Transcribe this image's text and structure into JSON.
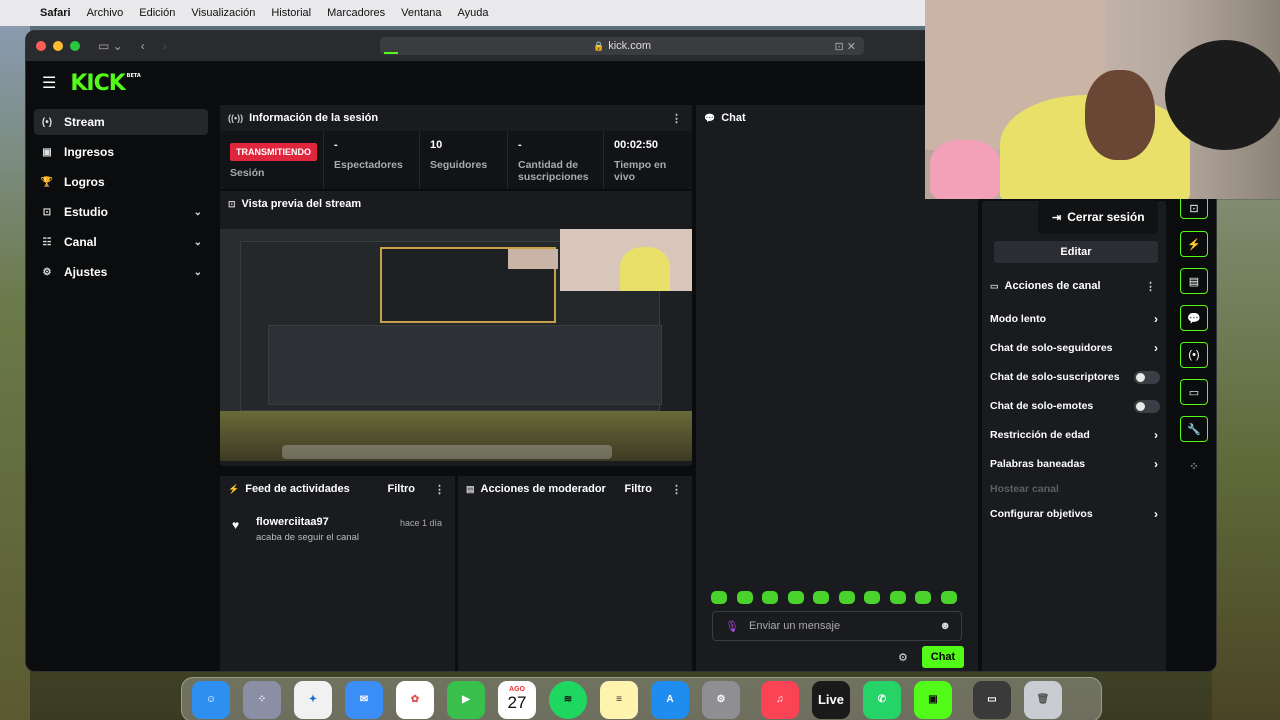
{
  "menubar": {
    "apple": "",
    "items": [
      "Safari",
      "Archivo",
      "Edición",
      "Visualización",
      "Historial",
      "Marcadores",
      "Ventana",
      "Ayuda"
    ]
  },
  "browser": {
    "url": "kick.com"
  },
  "header": {
    "logo": "KICK",
    "beta": "BETA"
  },
  "sidebar": {
    "items": [
      {
        "label": "Stream",
        "icon": "broadcast-icon"
      },
      {
        "label": "Ingresos",
        "icon": "revenue-icon"
      },
      {
        "label": "Logros",
        "icon": "trophy-icon"
      },
      {
        "label": "Estudio",
        "icon": "studio-icon"
      },
      {
        "label": "Canal",
        "icon": "channel-icon"
      },
      {
        "label": "Ajustes",
        "icon": "gear-icon"
      }
    ]
  },
  "session": {
    "title": "Información de la sesión",
    "badge": "TRANSMITIENDO",
    "session_label": "Sesión",
    "stats": [
      {
        "value": "-",
        "label": "Espectadores"
      },
      {
        "value": "10",
        "label": "Seguidores"
      },
      {
        "value": "-",
        "label": "Cantidad de suscripciones"
      },
      {
        "value": "00:02:50",
        "label": "Tiempo en vivo"
      }
    ]
  },
  "preview": {
    "title": "Vista previa del stream"
  },
  "feed": {
    "title": "Feed de actividades",
    "filter": "Filtro",
    "items": [
      {
        "user": "flowerciitaa97",
        "time": "hace 1 día",
        "action": "acaba de seguir el canal"
      }
    ]
  },
  "mod": {
    "title": "Acciones de moderador",
    "filter": "Filtro"
  },
  "chat": {
    "title": "Chat",
    "placeholder": "Enviar un mensaje",
    "send": "Chat"
  },
  "channel_actions": {
    "logout": "Cerrar sesión",
    "edit": "Editar",
    "title": "Acciones de canal",
    "rows": [
      {
        "label": "Modo lento",
        "control": "chevron"
      },
      {
        "label": "Chat de solo-seguidores",
        "control": "chevron"
      },
      {
        "label": "Chat de solo-suscriptores",
        "control": "toggle",
        "on": false
      },
      {
        "label": "Chat de solo-emotes",
        "control": "toggle",
        "on": false
      },
      {
        "label": "Restricción de edad",
        "control": "chevron"
      },
      {
        "label": "Palabras baneadas",
        "control": "chevron"
      },
      {
        "label": "Hostear canal",
        "control": "none",
        "disabled": true
      },
      {
        "label": "Configurar objetivos",
        "control": "chevron"
      }
    ]
  },
  "dock": {
    "calendar_month": "AGO",
    "calendar_day": "27",
    "live_label": "Live"
  },
  "colors": {
    "accent": "#53fc18",
    "live_badge": "#e0263c"
  }
}
